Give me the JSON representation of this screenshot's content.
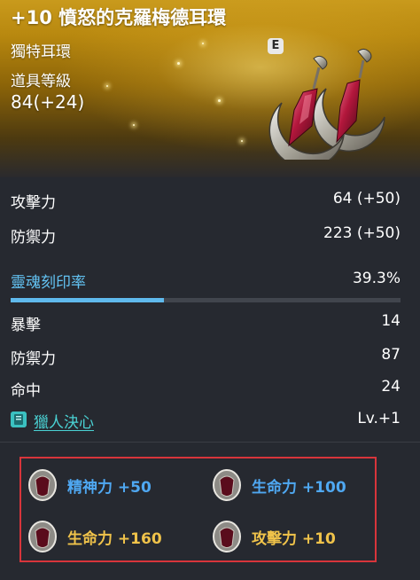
{
  "header": {
    "title": "+10 憤怒的克羅梅德耳環",
    "subtitle": "獨特耳環",
    "grade_badge": "E",
    "item_level_label": "道具等級",
    "item_level_value": "84(+24)"
  },
  "base_stats": [
    {
      "label": "攻擊力",
      "value": "64 (+50)"
    },
    {
      "label": "防禦力",
      "value": "223 (+50)"
    }
  ],
  "soul_engraving": {
    "label": "靈魂刻印率",
    "value": "39.3%",
    "progress": 0.393
  },
  "sub_stats": [
    {
      "label": "暴擊",
      "value": "14"
    },
    {
      "label": "防禦力",
      "value": "87"
    },
    {
      "label": "命中",
      "value": "24"
    }
  ],
  "skill": {
    "label": "獵人決心",
    "value": "Lv.+1",
    "icon": "skill-book-icon"
  },
  "bonuses": [
    {
      "text": "精神力 +50",
      "color": "#4fa8f2",
      "icon": "gem-icon"
    },
    {
      "text": "生命力 +100",
      "color": "#4fa8f2",
      "icon": "gem-icon"
    },
    {
      "text": "生命力 +160",
      "color": "#f0c34a",
      "icon": "gem-icon"
    },
    {
      "text": "攻擊力 +10",
      "color": "#f0c34a",
      "icon": "gem-icon"
    }
  ],
  "colors": {
    "accent_blue": "#63c3f3",
    "highlight_border": "#d8353b",
    "skill_teal": "#4ad2d4"
  }
}
